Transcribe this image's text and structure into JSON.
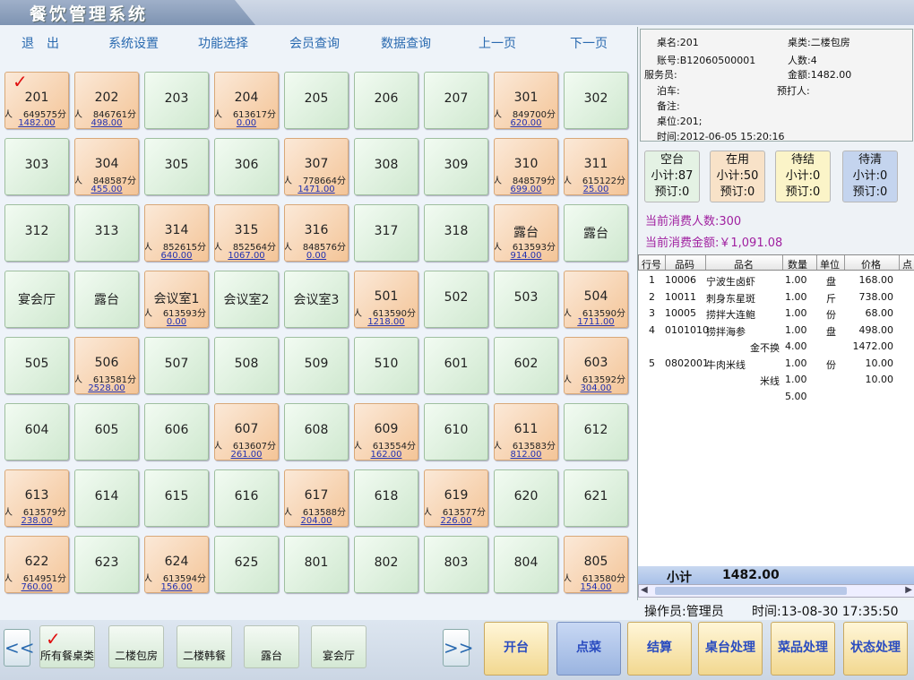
{
  "app": {
    "title": "餐饮管理系统"
  },
  "menu": [
    "退　出",
    "系统设置",
    "功能选择",
    "会员查询",
    "数据查询",
    "上一页",
    "下一页"
  ],
  "tables": [
    {
      "name": "201",
      "status": "busy",
      "people": "人",
      "code": "649575分",
      "amount": "1482.00",
      "checked": true
    },
    {
      "name": "202",
      "status": "busy",
      "people": "人",
      "code": "846761分",
      "amount": "498.00"
    },
    {
      "name": "203",
      "status": "free"
    },
    {
      "name": "204",
      "status": "busy",
      "people": "人",
      "code": "613617分",
      "amount": "0.00"
    },
    {
      "name": "205",
      "status": "free"
    },
    {
      "name": "206",
      "status": "free"
    },
    {
      "name": "207",
      "status": "free"
    },
    {
      "name": "301",
      "status": "busy",
      "people": "人",
      "code": "849700分",
      "amount": "620.00"
    },
    {
      "name": "302",
      "status": "free"
    },
    {
      "name": "303",
      "status": "free"
    },
    {
      "name": "304",
      "status": "busy",
      "people": "人",
      "code": "848587分",
      "amount": "455.00"
    },
    {
      "name": "305",
      "status": "free"
    },
    {
      "name": "306",
      "status": "free"
    },
    {
      "name": "307",
      "status": "busy",
      "people": "人",
      "code": "778664分",
      "amount": "1471.00"
    },
    {
      "name": "308",
      "status": "free"
    },
    {
      "name": "309",
      "status": "free"
    },
    {
      "name": "310",
      "status": "busy",
      "people": "人",
      "code": "848579分",
      "amount": "699.00"
    },
    {
      "name": "311",
      "status": "busy",
      "people": "人",
      "code": "615122分",
      "amount": "25.00"
    },
    {
      "name": "312",
      "status": "free"
    },
    {
      "name": "313",
      "status": "free"
    },
    {
      "name": "314",
      "status": "busy",
      "people": "人",
      "code": "852615分",
      "amount": "640.00"
    },
    {
      "name": "315",
      "status": "busy",
      "people": "人",
      "code": "852564分",
      "amount": "1067.00"
    },
    {
      "name": "316",
      "status": "busy",
      "people": "人",
      "code": "848576分",
      "amount": "0.00"
    },
    {
      "name": "317",
      "status": "free"
    },
    {
      "name": "318",
      "status": "free"
    },
    {
      "name": "露台",
      "status": "busy",
      "people": "人",
      "code": "613593分",
      "amount": "914.00"
    },
    {
      "name": "露台",
      "status": "free"
    },
    {
      "name": "宴会厅",
      "status": "free"
    },
    {
      "name": "露台",
      "status": "free"
    },
    {
      "name": "会议室1",
      "status": "busy",
      "people": "人",
      "code": "613593分",
      "amount": "0.00"
    },
    {
      "name": "会议室2",
      "status": "free"
    },
    {
      "name": "会议室3",
      "status": "free"
    },
    {
      "name": "501",
      "status": "busy",
      "people": "人",
      "code": "613590分",
      "amount": "1218.00"
    },
    {
      "name": "502",
      "status": "free"
    },
    {
      "name": "503",
      "status": "free"
    },
    {
      "name": "504",
      "status": "busy",
      "people": "人",
      "code": "613590分",
      "amount": "1711.00"
    },
    {
      "name": "505",
      "status": "free"
    },
    {
      "name": "506",
      "status": "busy",
      "people": "人",
      "code": "613581分",
      "amount": "2528.00"
    },
    {
      "name": "507",
      "status": "free"
    },
    {
      "name": "508",
      "status": "free"
    },
    {
      "name": "509",
      "status": "free"
    },
    {
      "name": "510",
      "status": "free"
    },
    {
      "name": "601",
      "status": "free"
    },
    {
      "name": "602",
      "status": "free"
    },
    {
      "name": "603",
      "status": "busy",
      "people": "人",
      "code": "613592分",
      "amount": "304.00"
    },
    {
      "name": "604",
      "status": "free"
    },
    {
      "name": "605",
      "status": "free"
    },
    {
      "name": "606",
      "status": "free"
    },
    {
      "name": "607",
      "status": "busy",
      "people": "人",
      "code": "613607分",
      "amount": "261.00"
    },
    {
      "name": "608",
      "status": "free"
    },
    {
      "name": "609",
      "status": "busy",
      "people": "人",
      "code": "613554分",
      "amount": "162.00"
    },
    {
      "name": "610",
      "status": "free"
    },
    {
      "name": "611",
      "status": "busy",
      "people": "人",
      "code": "613583分",
      "amount": "812.00"
    },
    {
      "name": "612",
      "status": "free"
    },
    {
      "name": "613",
      "status": "busy",
      "people": "人",
      "code": "613579分",
      "amount": "238.00"
    },
    {
      "name": "614",
      "status": "free"
    },
    {
      "name": "615",
      "status": "free"
    },
    {
      "name": "616",
      "status": "free"
    },
    {
      "name": "617",
      "status": "busy",
      "people": "人",
      "code": "613588分",
      "amount": "204.00"
    },
    {
      "name": "618",
      "status": "free"
    },
    {
      "name": "619",
      "status": "busy",
      "people": "人",
      "code": "613577分",
      "amount": "226.00"
    },
    {
      "name": "620",
      "status": "free"
    },
    {
      "name": "621",
      "status": "free"
    },
    {
      "name": "622",
      "status": "busy",
      "people": "人",
      "code": "614951分",
      "amount": "760.00"
    },
    {
      "name": "623",
      "status": "free"
    },
    {
      "name": "624",
      "status": "busy",
      "people": "人",
      "code": "613594分",
      "amount": "156.00"
    },
    {
      "name": "625",
      "status": "free"
    },
    {
      "name": "801",
      "status": "free"
    },
    {
      "name": "802",
      "status": "free"
    },
    {
      "name": "803",
      "status": "free"
    },
    {
      "name": "804",
      "status": "free"
    },
    {
      "name": "805",
      "status": "busy",
      "people": "人",
      "code": "613580分",
      "amount": "154.00"
    }
  ],
  "info": {
    "table_name": "桌名:201",
    "table_type": "桌类:二楼包房",
    "account": "账号:B12060500001",
    "people": "人数:4",
    "waiter": "服务员:",
    "amount": "金额:1482.00",
    "parking": "泊车:",
    "booker": "预打人:",
    "remark": "备注:",
    "seat": "桌位:201;",
    "time": "时间:2012-06-05 15:20:16"
  },
  "stats": [
    {
      "title": "空台",
      "sub": "小计:87",
      "reserve": "预订:0",
      "color": "#e4f2e4"
    },
    {
      "title": "在用",
      "sub": "小计:50",
      "reserve": "预订:0",
      "color": "#f8e2c8"
    },
    {
      "title": "待结",
      "sub": "小计:0",
      "reserve": "预订:0",
      "color": "#fbf4c8"
    },
    {
      "title": "待清",
      "sub": "小计:0",
      "reserve": "预订:0",
      "color": "#c4d4ee"
    }
  ],
  "summary": {
    "people": "当前消费人数:300",
    "amount": "当前消费金额:￥1,091.08"
  },
  "order": {
    "headers": [
      "行号",
      "品码",
      "品名",
      "数量",
      "单位",
      "价格",
      "点"
    ],
    "rows": [
      {
        "no": "1",
        "code": "10006",
        "name": "宁波生卤虾",
        "qty": "1.00",
        "unit": "盘",
        "price": "168.00"
      },
      {
        "no": "2",
        "code": "10011",
        "name": "刺身东星斑",
        "qty": "1.00",
        "unit": "斤",
        "price": "738.00"
      },
      {
        "no": "3",
        "code": "10005",
        "name": "捞拌大连鲍",
        "qty": "1.00",
        "unit": "份",
        "price": "68.00"
      },
      {
        "no": "4",
        "code": "0101010",
        "name": "捞拌海参",
        "qty": "1.00",
        "unit": "盘",
        "price": "498.00"
      },
      {
        "no": "",
        "code": "",
        "name": "金不换",
        "qty": "4.00",
        "unit": "",
        "price": "1472.00",
        "right": true
      },
      {
        "no": "5",
        "code": "0802001",
        "name": "牛肉米线",
        "qty": "1.00",
        "unit": "份",
        "price": "10.00"
      },
      {
        "no": "",
        "code": "",
        "name": "米线",
        "qty": "1.00",
        "unit": "",
        "price": "10.00",
        "right": true
      },
      {
        "no": "",
        "code": "",
        "name": "",
        "qty": "5.00",
        "unit": "",
        "price": ""
      }
    ],
    "subtotal_label": "小计",
    "subtotal_value": "1482.00"
  },
  "status": {
    "operator": "操作员:管理员",
    "time": "时间:13-08-30 17:35:50"
  },
  "categories": [
    "所有餐桌类",
    "二楼包房",
    "二楼韩餐",
    "露台",
    "宴会厅"
  ],
  "nav": {
    "prev": "<<",
    "next": ">>"
  },
  "actions": [
    "开台",
    "点菜",
    "结算",
    "桌台处理",
    "菜品处理",
    "状态处理"
  ]
}
